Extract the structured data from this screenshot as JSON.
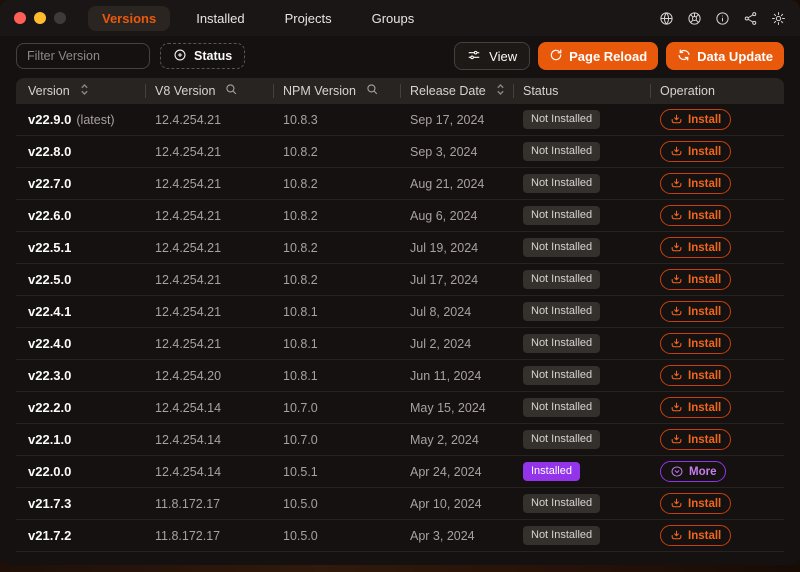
{
  "window": {
    "traffic_lights": [
      "close",
      "minimize",
      "zoom-disabled"
    ],
    "tabs": [
      {
        "label": "Versions",
        "active": true
      },
      {
        "label": "Installed",
        "active": false
      },
      {
        "label": "Projects",
        "active": false
      },
      {
        "label": "Groups",
        "active": false
      }
    ],
    "titlebar_icons": [
      "globe-icon",
      "color-wheel-icon",
      "info-icon",
      "share-icon",
      "settings-gear-icon"
    ],
    "accent_color": "#e8590c",
    "installed_color": "#9333ea"
  },
  "toolbar": {
    "filter_placeholder": "Filter Version",
    "status_button": "Status",
    "view_button": "View",
    "page_reload_button": "Page Reload",
    "data_update_button": "Data Update"
  },
  "table": {
    "columns": [
      {
        "label": "Version",
        "icon": "sort-icon"
      },
      {
        "label": "V8 Version",
        "icon": "search-icon"
      },
      {
        "label": "NPM Version",
        "icon": "search-icon"
      },
      {
        "label": "Release Date",
        "icon": "sort-icon"
      },
      {
        "label": "Status",
        "icon": null
      },
      {
        "label": "Operation",
        "icon": null
      }
    ],
    "rows": [
      {
        "version": "v22.9.0",
        "tag": "(latest)",
        "v8": "12.4.254.21",
        "npm": "10.8.3",
        "date": "Sep 17, 2024",
        "status": "Not Installed",
        "installed": false,
        "action": "Install"
      },
      {
        "version": "v22.8.0",
        "tag": "",
        "v8": "12.4.254.21",
        "npm": "10.8.2",
        "date": "Sep 3, 2024",
        "status": "Not Installed",
        "installed": false,
        "action": "Install"
      },
      {
        "version": "v22.7.0",
        "tag": "",
        "v8": "12.4.254.21",
        "npm": "10.8.2",
        "date": "Aug 21, 2024",
        "status": "Not Installed",
        "installed": false,
        "action": "Install"
      },
      {
        "version": "v22.6.0",
        "tag": "",
        "v8": "12.4.254.21",
        "npm": "10.8.2",
        "date": "Aug 6, 2024",
        "status": "Not Installed",
        "installed": false,
        "action": "Install"
      },
      {
        "version": "v22.5.1",
        "tag": "",
        "v8": "12.4.254.21",
        "npm": "10.8.2",
        "date": "Jul 19, 2024",
        "status": "Not Installed",
        "installed": false,
        "action": "Install"
      },
      {
        "version": "v22.5.0",
        "tag": "",
        "v8": "12.4.254.21",
        "npm": "10.8.2",
        "date": "Jul 17, 2024",
        "status": "Not Installed",
        "installed": false,
        "action": "Install"
      },
      {
        "version": "v22.4.1",
        "tag": "",
        "v8": "12.4.254.21",
        "npm": "10.8.1",
        "date": "Jul 8, 2024",
        "status": "Not Installed",
        "installed": false,
        "action": "Install"
      },
      {
        "version": "v22.4.0",
        "tag": "",
        "v8": "12.4.254.21",
        "npm": "10.8.1",
        "date": "Jul 2, 2024",
        "status": "Not Installed",
        "installed": false,
        "action": "Install"
      },
      {
        "version": "v22.3.0",
        "tag": "",
        "v8": "12.4.254.20",
        "npm": "10.8.1",
        "date": "Jun 11, 2024",
        "status": "Not Installed",
        "installed": false,
        "action": "Install"
      },
      {
        "version": "v22.2.0",
        "tag": "",
        "v8": "12.4.254.14",
        "npm": "10.7.0",
        "date": "May 15, 2024",
        "status": "Not Installed",
        "installed": false,
        "action": "Install"
      },
      {
        "version": "v22.1.0",
        "tag": "",
        "v8": "12.4.254.14",
        "npm": "10.7.0",
        "date": "May 2, 2024",
        "status": "Not Installed",
        "installed": false,
        "action": "Install"
      },
      {
        "version": "v22.0.0",
        "tag": "",
        "v8": "12.4.254.14",
        "npm": "10.5.1",
        "date": "Apr 24, 2024",
        "status": "Installed",
        "installed": true,
        "action": "More"
      },
      {
        "version": "v21.7.3",
        "tag": "",
        "v8": "11.8.172.17",
        "npm": "10.5.0",
        "date": "Apr 10, 2024",
        "status": "Not Installed",
        "installed": false,
        "action": "Install"
      },
      {
        "version": "v21.7.2",
        "tag": "",
        "v8": "11.8.172.17",
        "npm": "10.5.0",
        "date": "Apr 3, 2024",
        "status": "Not Installed",
        "installed": false,
        "action": "Install"
      }
    ]
  }
}
